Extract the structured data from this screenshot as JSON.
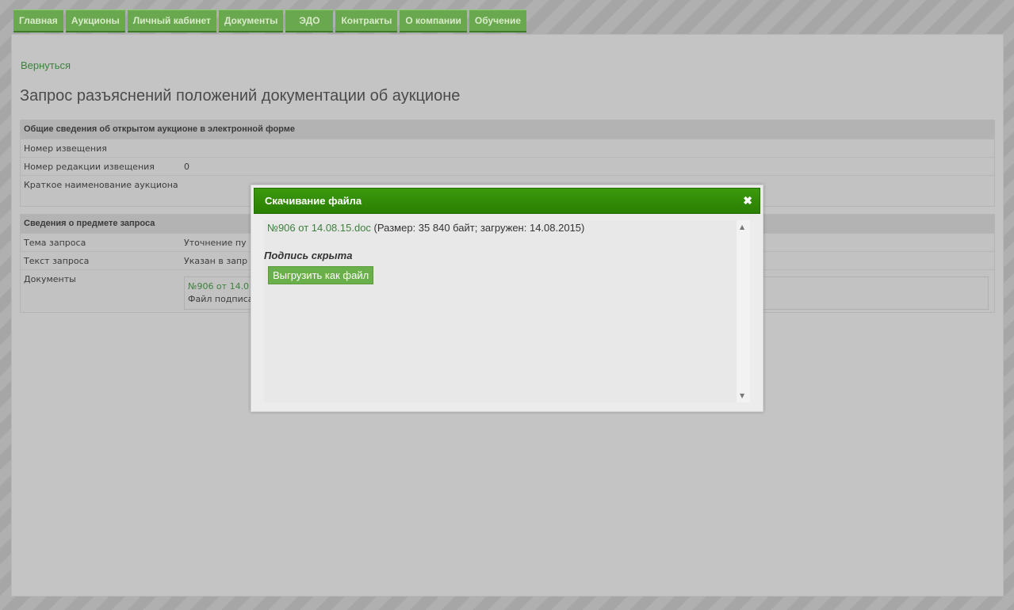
{
  "nav": {
    "tabs": [
      "Главная",
      "Аукционы",
      "Личный кабинет",
      "Документы",
      "ЭДО",
      "Контракты",
      "О компании",
      "Обучение"
    ]
  },
  "page": {
    "back_link": "Вернуться",
    "title": "Запрос разъяснений положений документации об аукционе"
  },
  "general_section": {
    "heading": "Общие сведения об открытом аукционе в электронной форме",
    "rows": [
      {
        "label": "Номер извещения",
        "value": ""
      },
      {
        "label": "Номер редакции извещения",
        "value": "0"
      },
      {
        "label": "Краткое наименование аукциона",
        "value": ""
      }
    ]
  },
  "request_section": {
    "heading": "Сведения о предмете запроса",
    "rows": [
      {
        "label": "Тема запроса",
        "value": "Уточнение пу"
      },
      {
        "label": "Текст запроса",
        "value": "Указан в запр"
      },
      {
        "label": "Документы",
        "doc_link": "№906 от 14.0",
        "doc_note": "Файл подписа"
      }
    ]
  },
  "modal": {
    "title": "Скачивание файла",
    "close_glyph": "✖",
    "file_link": "№906 от 14.08.15.doc",
    "file_info": " (Размер: 35 840 байт; загружен: 14.08.2015)",
    "signature_status": "Подпись скрыта",
    "export_button": "Выгрузить как файл",
    "scroll_up": "▲",
    "scroll_down": "▼"
  }
}
